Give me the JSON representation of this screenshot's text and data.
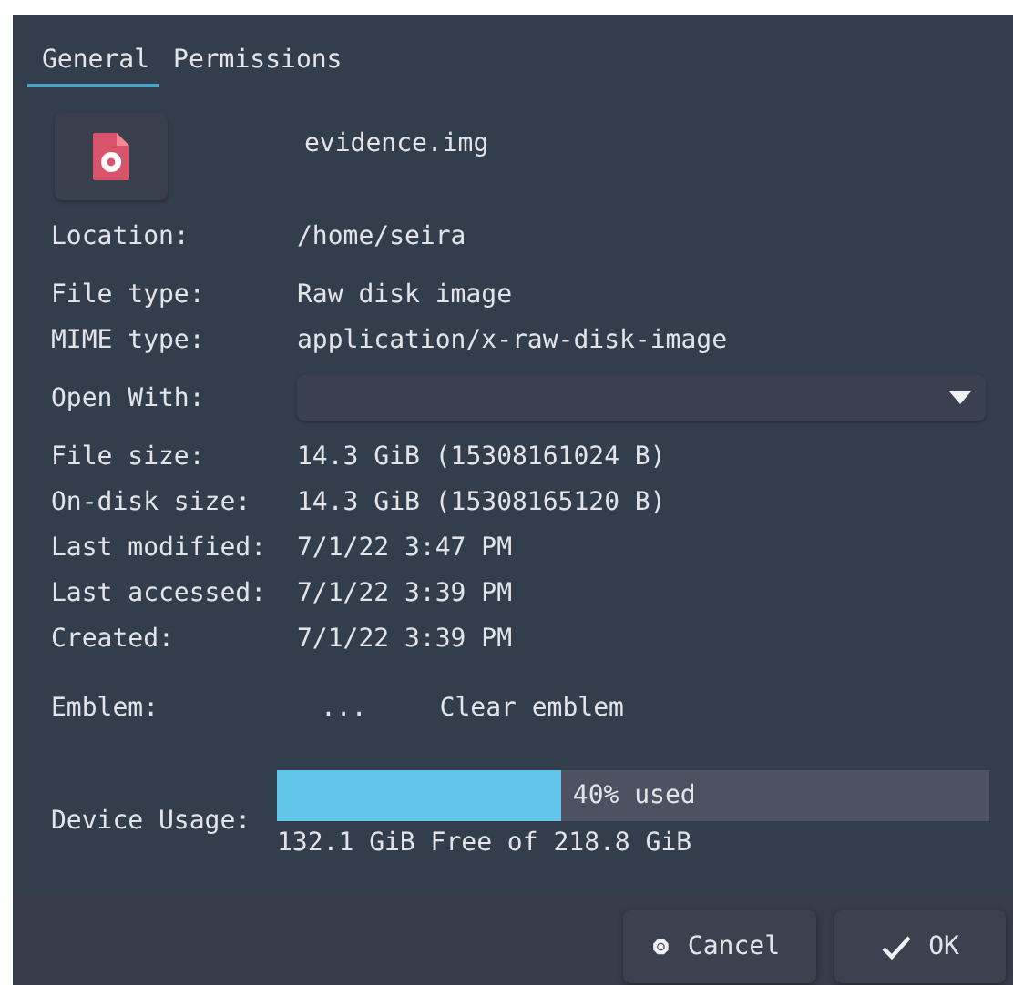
{
  "tabs": [
    {
      "label": "General",
      "selected": true
    },
    {
      "label": "Permissions",
      "selected": false
    }
  ],
  "file_name": "evidence.img",
  "groups": [
    [
      {
        "kind": "text",
        "label": "Location:",
        "value": "/home/seira"
      }
    ],
    [
      {
        "kind": "text",
        "label": "File type:",
        "value": "Raw disk image"
      },
      {
        "kind": "text",
        "label": "MIME type:",
        "value": "application/x-raw-disk-image"
      }
    ],
    [
      {
        "kind": "dropdown",
        "label": "Open With:"
      }
    ],
    [
      {
        "kind": "text",
        "label": "File size:",
        "value": "14.3 GiB (15308161024 B)"
      },
      {
        "kind": "text",
        "label": "On-disk size:",
        "value": "14.3 GiB (15308165120 B)"
      },
      {
        "kind": "text",
        "label": "Last modified:",
        "value": "7/1/22 3:47 PM"
      },
      {
        "kind": "text",
        "label": "Last accessed:",
        "value": "7/1/22 3:39 PM"
      },
      {
        "kind": "text",
        "label": "Created:",
        "value": "7/1/22 3:39 PM"
      }
    ]
  ],
  "emblem": {
    "label": "Emblem:",
    "button": "...",
    "clear": "Clear emblem"
  },
  "device_usage": {
    "label": "Device Usage:",
    "level": 0.4,
    "reading": "40% used",
    "free": "132.1 GiB Free of 218.8 GiB"
  },
  "buttons": [
    {
      "kind": "cancel",
      "label": "Cancel"
    },
    {
      "kind": "ok",
      "label": "OK"
    }
  ]
}
